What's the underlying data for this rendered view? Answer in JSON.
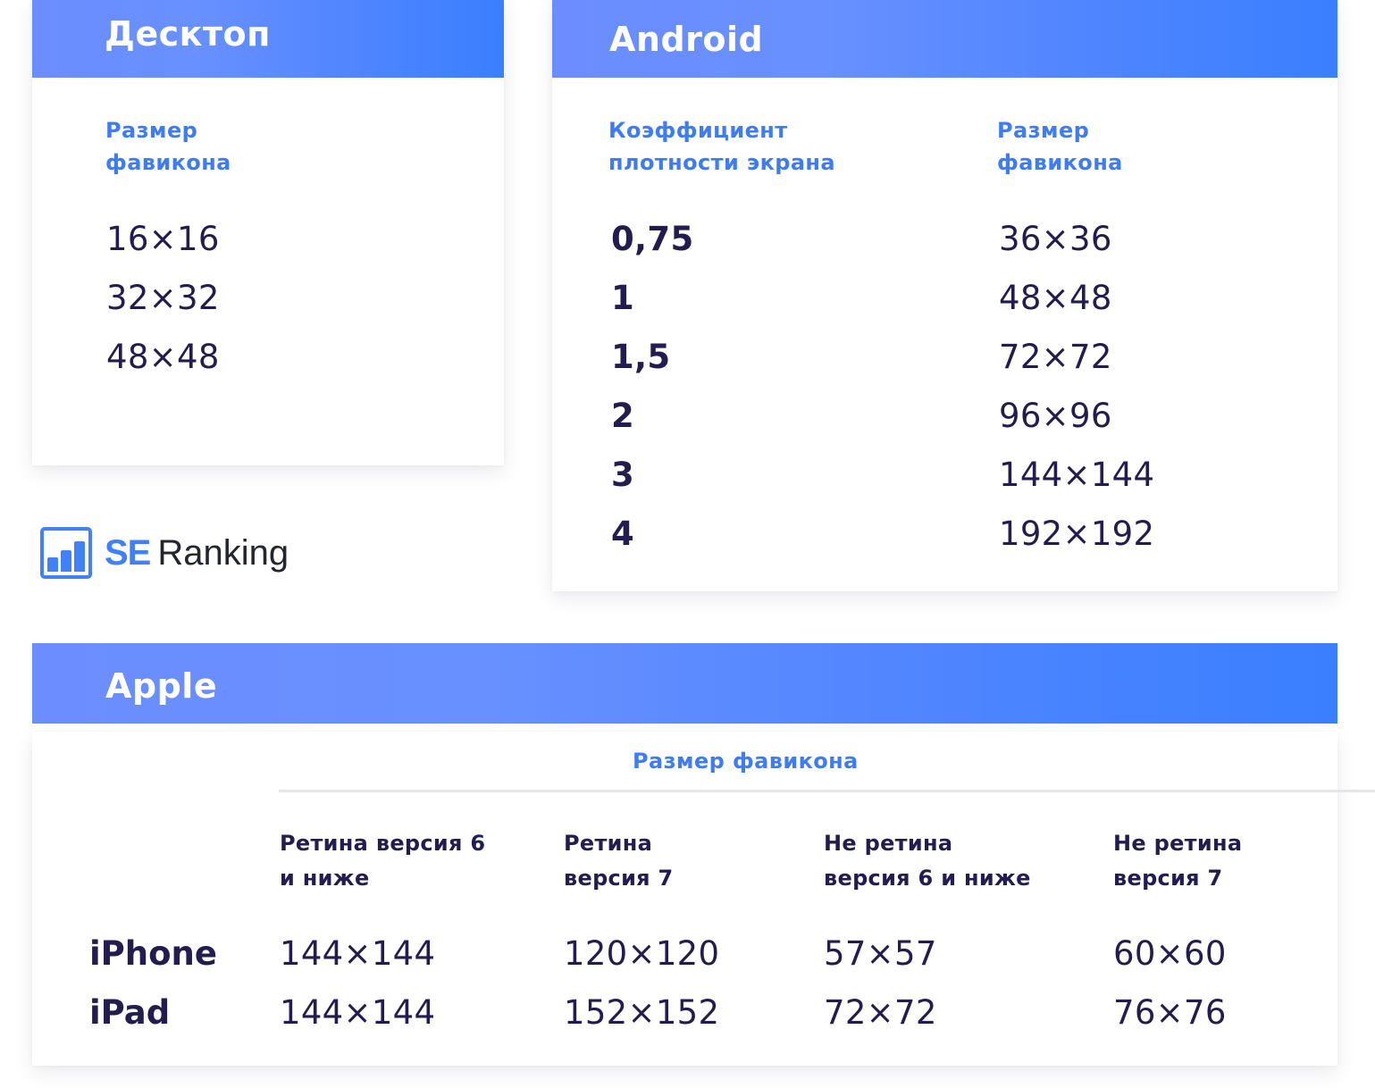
{
  "desktop": {
    "title": "Десктоп",
    "label_line1": "Размер",
    "label_line2": "фавикона",
    "sizes": [
      "16×16",
      "32×32",
      "48×48"
    ]
  },
  "android": {
    "title": "Android",
    "col1_line1": "Коэффициент",
    "col1_line2": "плотности экрана",
    "col2_line1": "Размер",
    "col2_line2": "фавикона",
    "rows": [
      {
        "density": "0,75",
        "size": "36×36"
      },
      {
        "density": "1",
        "size": "48×48"
      },
      {
        "density": "1,5",
        "size": "72×72"
      },
      {
        "density": "2",
        "size": "96×96"
      },
      {
        "density": "3",
        "size": "144×144"
      },
      {
        "density": "4",
        "size": "192×192"
      }
    ]
  },
  "logo": {
    "icon": "bar-chart-icon",
    "brand_part1": "SE",
    "brand_part2": "Ranking",
    "color": "#4181f5"
  },
  "apple": {
    "title": "Apple",
    "group_label": "Размер фавикона",
    "columns": [
      {
        "line1": "Ретина версия 6",
        "line2": "и ниже"
      },
      {
        "line1": "Ретина",
        "line2": "версия 7"
      },
      {
        "line1": "Не ретина",
        "line2": "версия 6 и ниже"
      },
      {
        "line1": "Не ретина",
        "line2": "версия 7"
      }
    ],
    "rows": [
      {
        "device": "iPhone",
        "values": [
          "144×144",
          "120×120",
          "57×57",
          "60×60"
        ]
      },
      {
        "device": "iPad",
        "values": [
          "144×144",
          "152×152",
          "72×72",
          "76×76"
        ]
      }
    ]
  },
  "colors": {
    "header_gradient_start": "#6c8dff",
    "header_gradient_end": "#3a7fff",
    "label_blue": "#3f7cf2",
    "text_dark": "#221c4f"
  }
}
